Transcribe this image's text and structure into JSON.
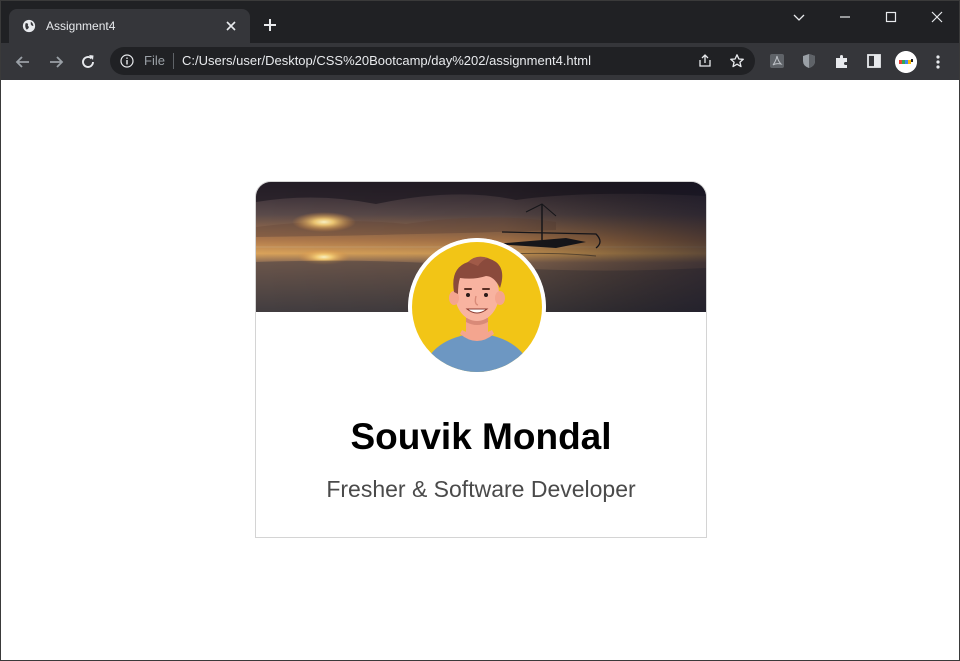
{
  "browser": {
    "tab": {
      "title": "Assignment4",
      "favicon": "globe-icon",
      "close": "close-icon"
    },
    "new_tab": "plus-icon",
    "window_controls": [
      "tab-search-icon",
      "minimize-icon",
      "maximize-icon",
      "close-window-icon"
    ],
    "toolbar": {
      "back": "back-arrow-icon",
      "forward": "forward-arrow-icon",
      "reload": "reload-icon",
      "site_info": "info-icon",
      "scheme_label": "File",
      "url": "C:/Users/user/Desktop/CSS%20Bootcamp/day%202/assignment4.html",
      "share": "share-icon",
      "bookmark": "star-icon",
      "extensions": [
        "pdf-icon",
        "shield-icon",
        "puzzle-icon",
        "side-panel-icon"
      ],
      "profile": "avatar",
      "menu": "more-vert-icon"
    },
    "colors": {
      "tabstrip": "#202124",
      "toolbar": "#35363a",
      "omnibox": "#202124",
      "text": "#e8eaed"
    }
  },
  "page": {
    "card": {
      "banner": "sunset-boat-image",
      "profile_image": "cartoon-man-avatar",
      "name": "Souvik Mondal",
      "role": "Fresher & Software Developer"
    },
    "colors": {
      "avatar_bg": "#f2c516",
      "shirt": "#6d97c2",
      "name_text": "#000000",
      "role_text": "#4a4a4a",
      "card_border": "#d4d4d4"
    }
  }
}
